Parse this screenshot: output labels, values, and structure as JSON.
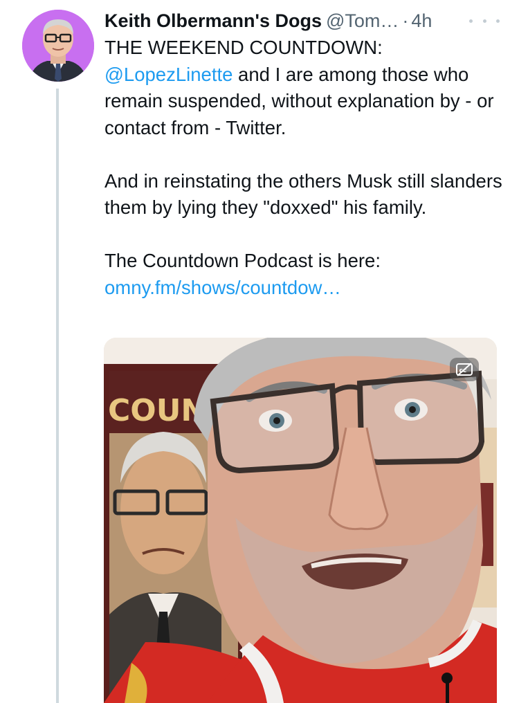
{
  "author": {
    "display_name": "Keith Olbermann's Dogs",
    "handle": "@Tom…",
    "separator": "·",
    "time": "4h"
  },
  "icons": {
    "more": "more-horizontal-icon",
    "captions": "closed-captions-off-icon"
  },
  "tweet": {
    "line1": "THE WEEKEND COUNTDOWN:",
    "mention": "@LopezLinette",
    "after_mention": " and I are among those who remain suspended, without explanation by - or contact from - Twitter.",
    "para2": "And in reinstating the others Musk still slanders them by lying they \"doxxed\" his family.",
    "para3": "The Countdown Podcast is here:",
    "url_text": "omny.fm/shows/countdow…"
  },
  "media": {
    "poster_text": "COUN"
  },
  "colors": {
    "link": "#1d9bf0",
    "secondary_text": "#536471",
    "thread_line": "#cfd9de",
    "avatar_bg": "#c86ff0"
  }
}
